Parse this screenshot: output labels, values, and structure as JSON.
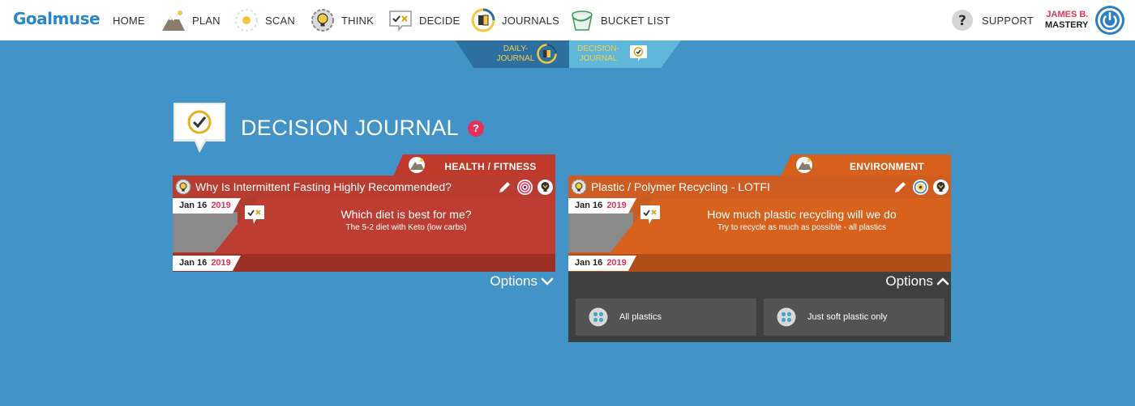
{
  "brand": {
    "logo": "Goalmuse"
  },
  "nav": {
    "home": "HOME",
    "plan": "PLAN",
    "scan": "SCAN",
    "think": "THINK",
    "decide": "DECIDE",
    "journals": "JOURNALS",
    "bucket_list": "BUCKET LIST",
    "support": "SUPPORT"
  },
  "user": {
    "first": "JAMES B.",
    "last": "MASTERY"
  },
  "tabs": {
    "daily": "DAILY-JOURNAL",
    "decision": "DECISION-JOURNAL",
    "active": "decision"
  },
  "page": {
    "title": "DECISION JOURNAL",
    "help": "?"
  },
  "cards": [
    {
      "category": "HEALTH / FITNESS",
      "title": "Why Is Intermittent Fasting Highly Recommended?",
      "date_top": {
        "day": "Jan 16",
        "year": "2019"
      },
      "date_bottom": {
        "day": "Jan 16",
        "year": "2019"
      },
      "question": "Which diet is best for me?",
      "answer": "The 5-2 diet with Keto (low carbs)",
      "options_label": "Options",
      "options_expanded": false,
      "options": []
    },
    {
      "category": "ENVIRONMENT",
      "title": "Plastic / Polymer Recycling - LOTFI",
      "date_top": {
        "day": "Jan 16",
        "year": "2019"
      },
      "date_bottom": {
        "day": "Jan 16",
        "year": "2019"
      },
      "question": "How much plastic recycling will we do",
      "answer": "Try to recycle as much as possible - all plastics",
      "options_label": "Options",
      "options_expanded": true,
      "options": [
        "All plastics",
        "Just soft plastic only"
      ]
    }
  ],
  "colors": {
    "background": "#4293c8",
    "accent_pink": "#e6325a",
    "health_red": "#b93c30",
    "environment_orange": "#cf5d21"
  }
}
